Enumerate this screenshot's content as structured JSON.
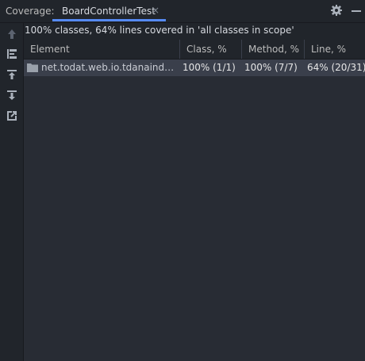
{
  "header": {
    "label": "Coverage:",
    "tab_title": "BoardControllerTest",
    "tab_close": "×"
  },
  "summary": "100% classes, 64% lines covered in 'all classes in scope'",
  "table": {
    "columns": [
      "Element",
      "Class, %",
      "Method, %",
      "Line, %"
    ],
    "rows": [
      {
        "element": "net.todat.web.io.tdanaindexsc",
        "class_pct": "100% (1/1)",
        "method_pct": "100% (7/7)",
        "line_pct": "64% (20/31)"
      }
    ]
  },
  "icons": {
    "gear": "gear-icon",
    "minimize": "minimize-icon",
    "toolbar": [
      "arrow-up-icon",
      "flatten-packages-icon",
      "import-coverage-icon",
      "export-coverage-icon",
      "open-external-icon"
    ],
    "row": "folder-icon"
  },
  "colors": {
    "accent": "#568af2",
    "background": "#21252b",
    "table_bg": "#282c34",
    "selected_row": "#3a3f4b"
  }
}
